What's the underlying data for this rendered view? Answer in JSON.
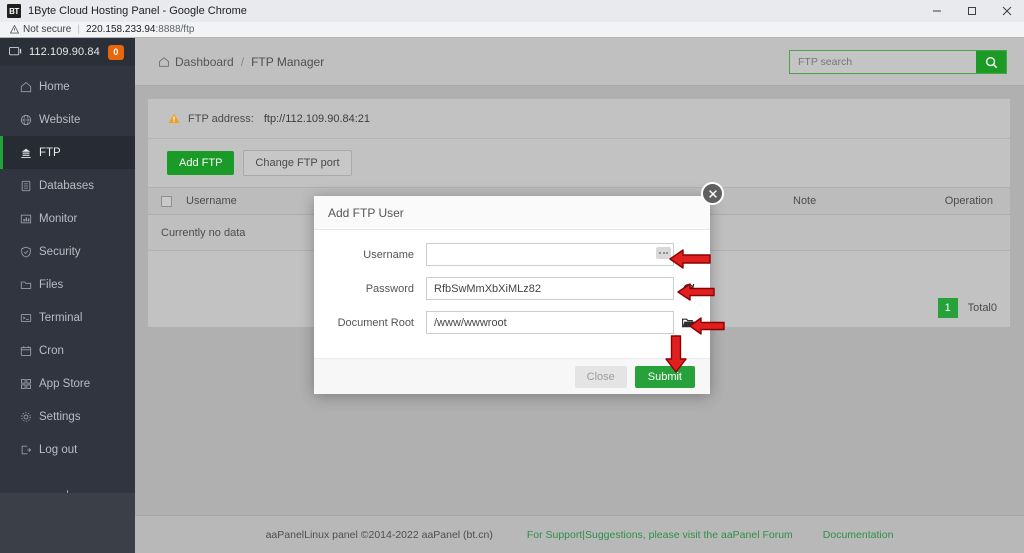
{
  "browser": {
    "favicon_text": "BT",
    "window_title": "1Byte Cloud Hosting Panel - Google Chrome",
    "security_label": "Not secure",
    "url_host": "220.158.233.94",
    "url_rest": ":8888/ftp",
    "minimize_icon": "minimize-icon",
    "maximize_icon": "maximize-icon",
    "close_icon": "close-icon"
  },
  "sidebar": {
    "server_ip": "112.109.90.84",
    "badge_count": "0",
    "add_label": "+",
    "items": [
      {
        "label": "Home",
        "icon": "home-icon"
      },
      {
        "label": "Website",
        "icon": "globe-icon"
      },
      {
        "label": "FTP",
        "icon": "ftp-icon"
      },
      {
        "label": "Databases",
        "icon": "database-icon"
      },
      {
        "label": "Monitor",
        "icon": "monitor-icon"
      },
      {
        "label": "Security",
        "icon": "shield-icon"
      },
      {
        "label": "Files",
        "icon": "folder-icon"
      },
      {
        "label": "Terminal",
        "icon": "terminal-icon"
      },
      {
        "label": "Cron",
        "icon": "calendar-icon"
      },
      {
        "label": "App Store",
        "icon": "grid-icon"
      },
      {
        "label": "Settings",
        "icon": "gear-icon"
      },
      {
        "label": "Log out",
        "icon": "logout-icon"
      }
    ]
  },
  "header": {
    "breadcrumb_home": "Dashboard",
    "breadcrumb_sep": "/",
    "breadcrumb_current": "FTP Manager",
    "search_placeholder": "FTP search",
    "search_value": "",
    "search_icon": "search-icon"
  },
  "panel": {
    "ftp_address_label": "FTP address:",
    "ftp_address_value": "ftp://112.109.90.84:21",
    "add_ftp_label": "Add FTP",
    "change_port_label": "Change FTP port",
    "columns": {
      "username": "Username",
      "note": "Note",
      "operation": "Operation"
    },
    "empty_text": "Currently no data",
    "page_number": "1",
    "total_label": "Total0"
  },
  "modal": {
    "title": "Add FTP User",
    "close_icon": "close-icon",
    "fields": [
      {
        "label": "Username",
        "value": "",
        "placeholder": "",
        "icon": "dots-button"
      },
      {
        "label": "Password",
        "value": "RfbSwMmXbXiMLz82",
        "placeholder": "",
        "icon": "refresh-icon"
      },
      {
        "label": "Document Root",
        "value": "/www/wwwroot",
        "placeholder": "",
        "icon": "folder-icon"
      }
    ],
    "close_button": "Close",
    "submit_button": "Submit"
  },
  "footer": {
    "copyright": "aaPanelLinux panel ©2014-2022 aaPanel (bt.cn)",
    "support_text": "For Support|Suggestions, please visit the aaPanel Forum",
    "documentation": "Documentation"
  },
  "annotations": {
    "color": "#e02020",
    "arrows": [
      {
        "name": "arrow-to-username-field",
        "direction": "left"
      },
      {
        "name": "arrow-to-password-refresh",
        "direction": "left"
      },
      {
        "name": "arrow-to-document-root-browse",
        "direction": "left"
      },
      {
        "name": "arrow-to-submit-button",
        "direction": "down"
      }
    ]
  },
  "colors": {
    "accent_green": "#1a9b27",
    "sidebar_bg": "#30353f",
    "badge_orange": "#e8660e",
    "annotation_red": "#e02020"
  }
}
